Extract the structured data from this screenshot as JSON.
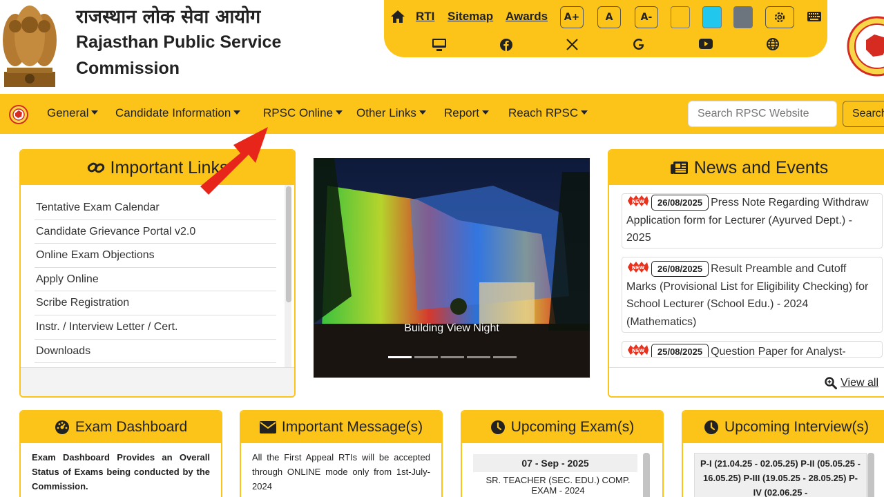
{
  "header": {
    "title_hindi": "राजस्थान लोक सेवा आयोग",
    "title_english": "Rajasthan Public Service Commission"
  },
  "topbar": {
    "links": [
      "RTI",
      "Sitemap",
      "Awards"
    ],
    "font_buttons": [
      "A+",
      "A",
      "A-"
    ],
    "theme_colors": [
      "#fcc419",
      "#22c7ee",
      "#6c757d"
    ],
    "row1_icons": [
      "home-icon",
      "settings-icon",
      "keyboard-icon"
    ],
    "row2_icons": [
      "desktop-icon",
      "facebook-icon",
      "x-icon",
      "google-icon",
      "youtube-icon",
      "globe-icon"
    ]
  },
  "nav": {
    "items": [
      "General",
      "Candidate Information",
      "RPSC Online",
      "Other Links",
      "Report",
      "Reach RPSC"
    ],
    "search_placeholder": "Search RPSC Website",
    "search_button": "Search"
  },
  "important_links": {
    "title": "Important Links",
    "items": [
      "Tentative Exam Calendar",
      "Candidate Grievance Portal v2.0",
      "Online Exam Objections",
      "Apply Online",
      "Scribe Registration",
      "Instr. / Interview Letter / Cert.",
      "Downloads"
    ]
  },
  "slider": {
    "caption": "Building View Night",
    "active_index": 0,
    "count": 5
  },
  "news": {
    "title": "News and Events",
    "items": [
      {
        "date": "26/08/2025",
        "text": "Press Note Regarding Withdraw Application form for Lecturer (Ayurved Dept.) - 2025"
      },
      {
        "date": "26/08/2025",
        "text": "Result Preamble and Cutoff Marks (Provisional List for Eligibility Checking) for School Lecturer (School Edu.) - 2024 (Mathematics)"
      },
      {
        "date": "25/08/2025",
        "text": "Question Paper for Analyst-"
      }
    ],
    "view_all": "View all"
  },
  "cards": {
    "exam_dashboard": {
      "title": "Exam Dashboard",
      "text": "Exam Dashboard Provides an Overall Status of Exams being conducted by the Commission."
    },
    "important_message": {
      "title": "Important Message(s)",
      "text": "All the First Appeal RTIs will be accepted through ONLINE mode only from 1st-July-2024"
    },
    "upcoming_exams": {
      "title": "Upcoming Exam(s)",
      "date": "07 - Sep - 2025",
      "text": "SR. TEACHER (SEC. EDU.) COMP. EXAM - 2024"
    },
    "upcoming_interviews": {
      "title": "Upcoming Interview(s)",
      "text": "P-I (21.04.25 - 02.05.25) P-II (05.05.25 - 16.05.25) P-III (19.05.25 - 28.05.25) P-IV (02.06.25 -"
    }
  }
}
